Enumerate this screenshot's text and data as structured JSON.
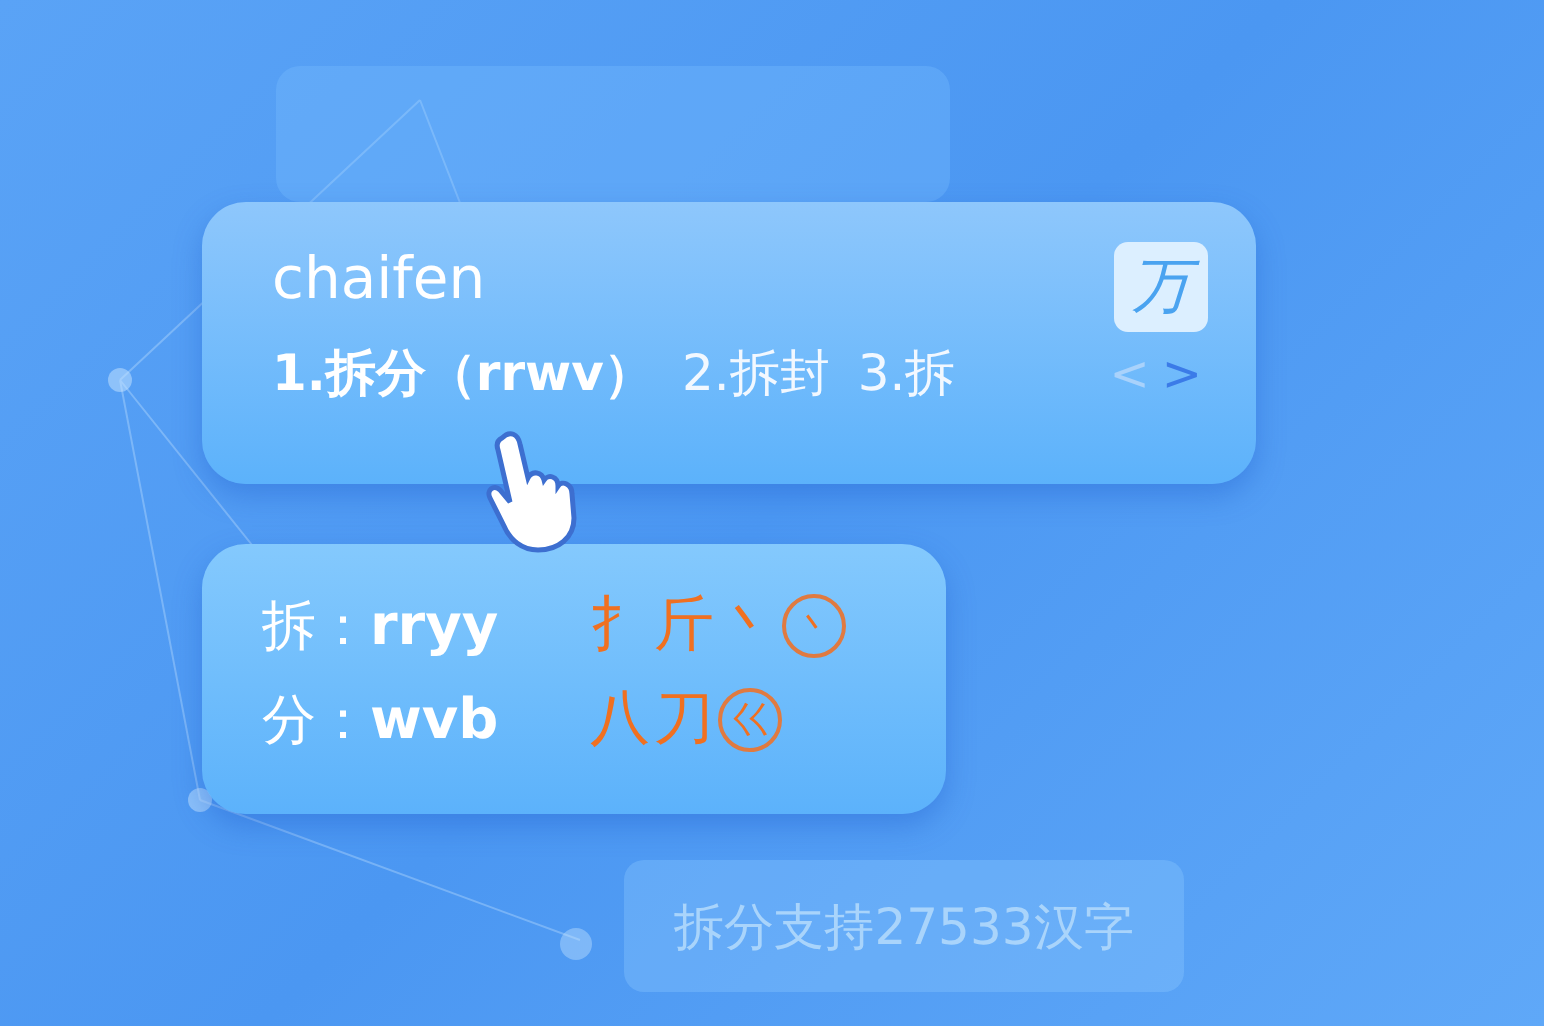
{
  "ime_window": {
    "pinyin": "chaifen",
    "logo": "万",
    "candidates": [
      {
        "label": "1.拆分（rrwv）",
        "selected": true
      },
      {
        "label": "2.拆封",
        "selected": false
      },
      {
        "label": "3.拆",
        "selected": false
      }
    ],
    "prev_page": {
      "label": "<",
      "disabled": true
    },
    "next_page": {
      "label": ">",
      "disabled": false
    }
  },
  "decomposition": [
    {
      "char": "拆：",
      "code": "rryy",
      "parts": [
        {
          "text": "扌",
          "circled": false
        },
        {
          "text": "斤",
          "circled": false
        },
        {
          "text": "丶",
          "circled": false
        },
        {
          "text": "丶",
          "circled": true
        }
      ]
    },
    {
      "char": "分：",
      "code": "wvb",
      "parts": [
        {
          "text": "八",
          "circled": false
        },
        {
          "text": "刀",
          "circled": false
        },
        {
          "text": "巜",
          "circled": true
        }
      ]
    }
  ],
  "badge": "拆分支持27533汉字"
}
